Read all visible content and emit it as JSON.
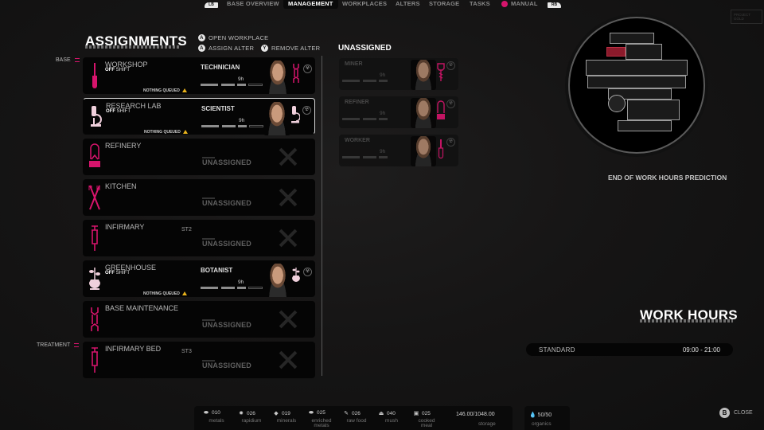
{
  "nav": {
    "left_bumper": "LB",
    "right_bumper": "RB",
    "tabs": [
      {
        "label": "BASE OVERVIEW",
        "active": false
      },
      {
        "label": "MANAGEMENT",
        "active": true
      },
      {
        "label": "WORKPLACES",
        "active": false
      },
      {
        "label": "ALTERS",
        "active": false
      },
      {
        "label": "STORAGE",
        "active": false
      },
      {
        "label": "TASKS",
        "active": false
      },
      {
        "label": "MANUAL",
        "active": false
      }
    ]
  },
  "page": {
    "title": "ASSIGNMENTS",
    "hints": {
      "open_workplace": "OPEN WORKPLACE",
      "assign_alter": "ASSIGN ALTER",
      "remove_alter": "REMOVE ALTER",
      "btn_a": "A",
      "btn_y": "Y"
    }
  },
  "groups": {
    "base": "BASE",
    "treatment": "TREATMENT"
  },
  "colors": {
    "accent": "#d6146c",
    "warning": "#e8b21b",
    "highlight_room": "#8b1a2b"
  },
  "workplaces": [
    {
      "name": "WORKSHOP",
      "icon": "screwdriver-icon",
      "shift_status": "OFF",
      "shift_word": "SHIFT",
      "role": "TECHNICIAN",
      "hours": "9h",
      "work_progress_segments": 3,
      "queue": "NOTHING QUEUED",
      "assigned": true
    },
    {
      "name": "RESEARCH LAB",
      "icon": "microscope-icon",
      "shift_status": "OFF",
      "shift_word": "SHIFT",
      "role": "SCIENTIST",
      "hours": "9h",
      "work_progress_segments": 3,
      "queue": "NOTHING QUEUED",
      "assigned": true,
      "selected": true
    },
    {
      "name": "REFINERY",
      "icon": "refinery-icon",
      "status": "UNASSIGNED",
      "assigned": false
    },
    {
      "name": "KITCHEN",
      "icon": "utensils-icon",
      "status": "UNASSIGNED",
      "assigned": false
    },
    {
      "name": "INFIRMARY",
      "icon": "syringe-icon",
      "tag": "ST2",
      "status": "UNASSIGNED",
      "assigned": false
    },
    {
      "name": "GREENHOUSE",
      "icon": "plant-icon",
      "shift_status": "OFF",
      "shift_word": "SHIFT",
      "role": "BOTANIST",
      "hours": "9h",
      "work_progress_segments": 3,
      "queue": "NOTHING QUEUED",
      "assigned": true
    },
    {
      "name": "BASE MAINTENANCE",
      "icon": "wrench-icon",
      "status": "UNASSIGNED",
      "assigned": false
    },
    {
      "name": "INFIRMARY BED",
      "icon": "syringe-icon",
      "tag": "ST3",
      "status": "UNASSIGNED",
      "assigned": false
    }
  ],
  "unassigned": {
    "title": "UNASSIGNED",
    "alters": [
      {
        "role": "MINER",
        "hours": "9h",
        "icon": "drill-icon"
      },
      {
        "role": "REFINER",
        "hours": "9h",
        "icon": "refinery-icon"
      },
      {
        "role": "WORKER",
        "hours": "9h",
        "icon": "screwdriver-icon"
      }
    ]
  },
  "map": {
    "prediction_label": "END OF WORK HOURS PREDICTION",
    "logo": "PROJECT GOLD"
  },
  "work_hours": {
    "title": "WORK HOURS",
    "mode": "STANDARD",
    "range": "09:00 - 21:00"
  },
  "resources": [
    {
      "name": "metals",
      "amount": "010",
      "icon": "metals-icon",
      "glyph": "⬬"
    },
    {
      "name": "rapidium",
      "amount": "026",
      "icon": "rapidium-icon",
      "glyph": "✹"
    },
    {
      "name": "minerals",
      "amount": "019",
      "icon": "minerals-icon",
      "glyph": "◆"
    },
    {
      "name": "enriched metals",
      "amount": "025",
      "icon": "enriched-metals-icon",
      "glyph": "⬬"
    },
    {
      "name": "raw food",
      "amount": "026",
      "icon": "raw-food-icon",
      "glyph": "✎"
    },
    {
      "name": "mush",
      "amount": "040",
      "icon": "mush-icon",
      "glyph": "⏏"
    },
    {
      "name": "cooked meal",
      "amount": "025",
      "icon": "cooked-meal-icon",
      "glyph": "▣"
    }
  ],
  "storage": {
    "amount": "146.00/1048.00",
    "label": "storage"
  },
  "organics": {
    "amount": "50/50",
    "label": "organics"
  },
  "close": {
    "button": "B",
    "label": "CLOSE"
  }
}
